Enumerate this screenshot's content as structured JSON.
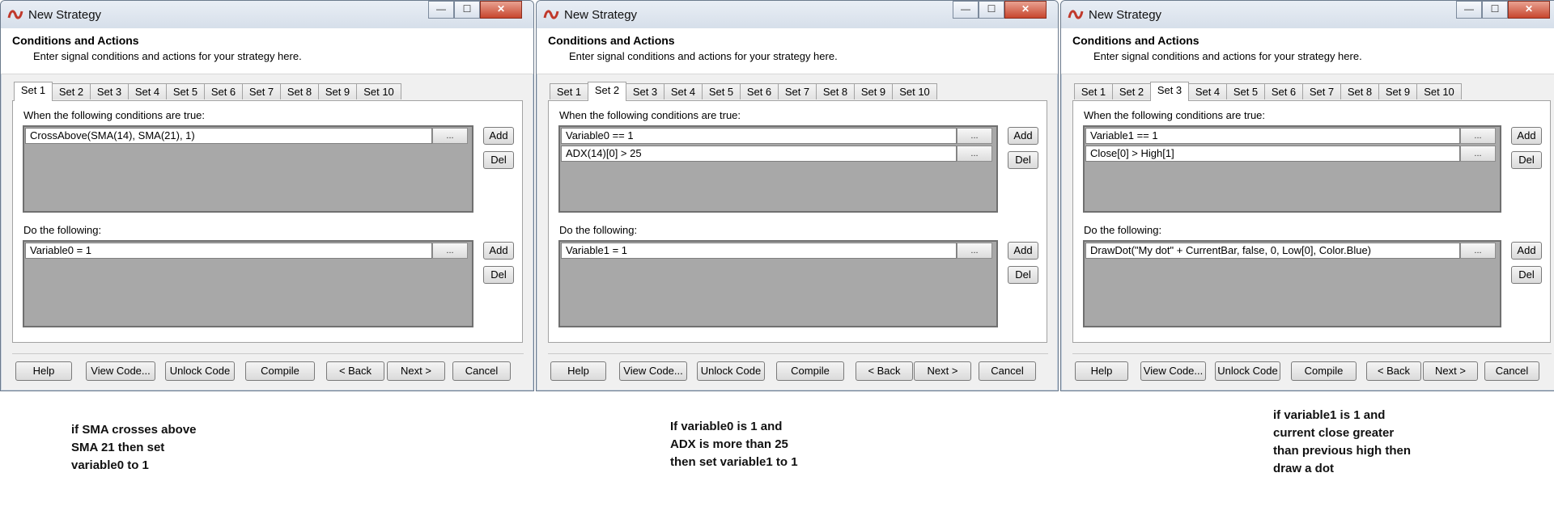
{
  "windows": [
    {
      "title": "New Strategy",
      "header_title": "Conditions and Actions",
      "header_subtitle": "Enter signal conditions and actions for your strategy here.",
      "tabs": [
        "Set 1",
        "Set 2",
        "Set 3",
        "Set 4",
        "Set 5",
        "Set 6",
        "Set 7",
        "Set 8",
        "Set 9",
        "Set 10"
      ],
      "active_tab": 0,
      "conditions_label": "When the following conditions are true:",
      "conditions": [
        "CrossAbove(SMA(14), SMA(21), 1)"
      ],
      "actions_label": "Do the following:",
      "actions": [
        "Variable0 = 1"
      ],
      "note": [
        "if SMA crosses above",
        "SMA 21 then set",
        "variable0 to 1"
      ]
    },
    {
      "title": "New Strategy",
      "header_title": "Conditions and Actions",
      "header_subtitle": "Enter signal conditions and actions for your strategy here.",
      "tabs": [
        "Set 1",
        "Set 2",
        "Set 3",
        "Set 4",
        "Set 5",
        "Set 6",
        "Set 7",
        "Set 8",
        "Set 9",
        "Set 10"
      ],
      "active_tab": 1,
      "conditions_label": "When the following conditions are true:",
      "conditions": [
        "Variable0 == 1",
        "ADX(14)[0] > 25"
      ],
      "actions_label": "Do the following:",
      "actions": [
        "Variable1 = 1"
      ],
      "note": [
        "If variable0 is 1 and",
        "ADX is more than 25",
        "then set variable1 to 1"
      ]
    },
    {
      "title": "New Strategy",
      "header_title": "Conditions and Actions",
      "header_subtitle": "Enter signal conditions and actions for your strategy here.",
      "tabs": [
        "Set 1",
        "Set 2",
        "Set 3",
        "Set 4",
        "Set 5",
        "Set 6",
        "Set 7",
        "Set 8",
        "Set 9",
        "Set 10"
      ],
      "active_tab": 2,
      "conditions_label": "When the following conditions are true:",
      "conditions": [
        "Variable1 == 1",
        "Close[0] > High[1]"
      ],
      "actions_label": "Do the following:",
      "actions": [
        "DrawDot(\"My dot\" + CurrentBar, false, 0, Low[0], Color.Blue)"
      ],
      "note": [
        "if variable1 is 1 and",
        "current close greater",
        "than previous high then",
        "draw a dot"
      ]
    }
  ],
  "labels": {
    "ellipsis": "...",
    "add": "Add",
    "del": "Del",
    "minimize": "—",
    "maximize": "☐",
    "close": "✕"
  },
  "buttons": {
    "help": "Help",
    "view_code": "View Code...",
    "unlock_code": "Unlock Code",
    "compile": "Compile",
    "back": "< Back",
    "next": "Next >",
    "cancel": "Cancel"
  },
  "colors": {
    "list_bg": "#a8a8a8",
    "close_button": "#c7462e",
    "app_icon": "#c0392b"
  }
}
